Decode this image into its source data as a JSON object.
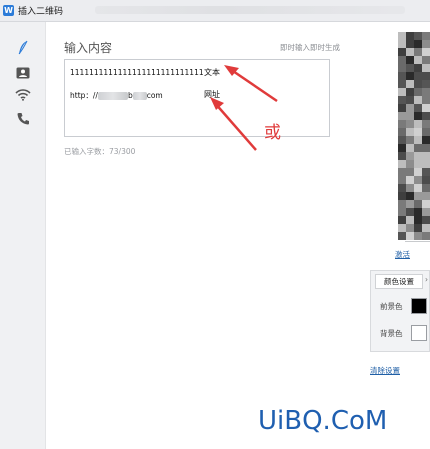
{
  "window": {
    "title": "插入二维码",
    "app_icon": "W"
  },
  "sidebar": {
    "items": [
      {
        "icon": "feather-pen-icon",
        "active": true
      },
      {
        "icon": "contact-card-icon",
        "active": false
      },
      {
        "icon": "wifi-icon",
        "active": false
      },
      {
        "icon": "phone-icon",
        "active": false
      }
    ]
  },
  "content": {
    "section_title": "输入内容",
    "live_generate": "即时输入即时生成",
    "line1": "1111111111111111111111111111",
    "line1_tag": "文本",
    "line2_prefix": "http：//",
    "line2_mid": "b",
    "line2_suffix": "com",
    "line2_tag": "网址",
    "char_count": "已输入字数：73/300",
    "annotation_or": "或"
  },
  "right": {
    "save_link": "激活",
    "color_tab": "颜色设置",
    "foreground_label": "前景色",
    "background_label": "背景色",
    "foreground_color": "#000000",
    "background_color": "#ffffff",
    "clear_link": "清除设置"
  },
  "watermark": {
    "text": "UiBQ.CoM"
  },
  "colors": {
    "arrow": "#e03b3b",
    "link": "#1f5fa6",
    "watermark": "#1f5fb0"
  }
}
